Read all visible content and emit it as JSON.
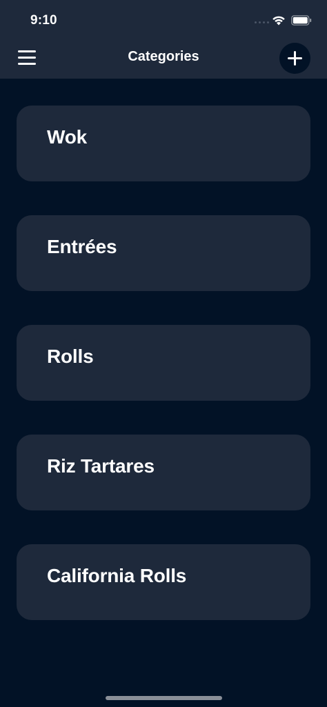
{
  "status_bar": {
    "time": "9:10",
    "icons": [
      "signal-dots",
      "wifi-icon",
      "battery-icon"
    ]
  },
  "header": {
    "title": "Categories",
    "menu_icon": "hamburger-menu-icon",
    "add_icon": "plus-icon"
  },
  "categories": [
    {
      "label": "Wok"
    },
    {
      "label": "Entrées"
    },
    {
      "label": "Rolls"
    },
    {
      "label": "Riz Tartares"
    },
    {
      "label": "California Rolls"
    }
  ],
  "colors": {
    "background": "#021226",
    "header_background": "#1e293b",
    "card_background": "#1e293b",
    "text": "#ffffff"
  }
}
